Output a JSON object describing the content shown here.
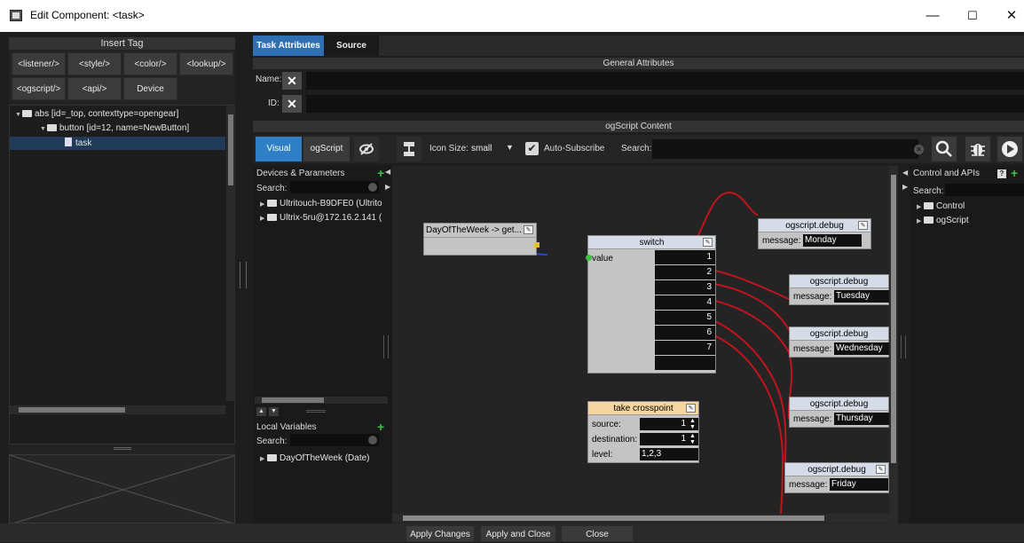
{
  "window": {
    "title": "Edit Component: <task>",
    "min": "—",
    "max": "☐",
    "close": "✕"
  },
  "insert_tag": {
    "header": "Insert Tag",
    "buttons": [
      "<listener/>",
      "<style/>",
      "<color/>",
      "<lookup/>",
      "<ogscript/>",
      "<api/>",
      "Device"
    ]
  },
  "tree": {
    "items": [
      "abs [id=_top, contexttype=opengear]",
      "button [id=12, name=NewButton]",
      "task"
    ]
  },
  "tabs": [
    "Task Attributes",
    "Source"
  ],
  "general": {
    "header": "General Attributes",
    "name_label": "Name:",
    "id_label": "ID:"
  },
  "ogscript_content": {
    "header": "ogScript Content"
  },
  "toolbar": {
    "visual": "Visual",
    "ogscript": "ogScript",
    "icon_size_label": "Icon Size:",
    "icon_size_value": "small",
    "auto_subscribe": "Auto-Subscribe",
    "search_label": "Search:"
  },
  "devices": {
    "header": "Devices & Parameters",
    "search_label": "Search:",
    "items": [
      "Ultritouch-B9DFE0 (Ultrito",
      "Ultrix-5ru@172.16.2.141 ("
    ]
  },
  "local_vars": {
    "header": "Local Variables",
    "search_label": "Search:",
    "items": [
      "DayOfTheWeek (Date)"
    ]
  },
  "control_apis": {
    "header": "Control and APIs",
    "search_label": "Search:",
    "items": [
      "Control",
      "ogScript"
    ]
  },
  "nodes": {
    "dow": {
      "title": "DayOfTheWeek -> get..."
    },
    "switch": {
      "title": "switch",
      "input": "value",
      "outputs": [
        "1",
        "2",
        "3",
        "4",
        "5",
        "6",
        "7"
      ]
    },
    "take": {
      "title": "take crosspoint",
      "fields": [
        {
          "label": "source:",
          "value": "1"
        },
        {
          "label": "destination:",
          "value": "1"
        },
        {
          "label": "level:",
          "value": "1,2,3"
        }
      ]
    },
    "debug": [
      {
        "title": "ogscript.debug",
        "label": "message:",
        "value": "Monday"
      },
      {
        "title": "ogscript.debug",
        "label": "message:",
        "value": "Tuesday"
      },
      {
        "title": "ogscript.debug",
        "label": "message:",
        "value": "Wednesday"
      },
      {
        "title": "ogscript.debug",
        "label": "message:",
        "value": "Thursday"
      },
      {
        "title": "ogscript.debug",
        "label": "message:",
        "value": "Friday"
      }
    ]
  },
  "footer": {
    "apply": "Apply Changes",
    "apply_close": "Apply and Close",
    "close": "Close"
  },
  "colors": {
    "accent": "#2f7fc6",
    "wire_red": "#c0141e",
    "wire_blue": "#2848c8",
    "add_green": "#3cc040"
  }
}
